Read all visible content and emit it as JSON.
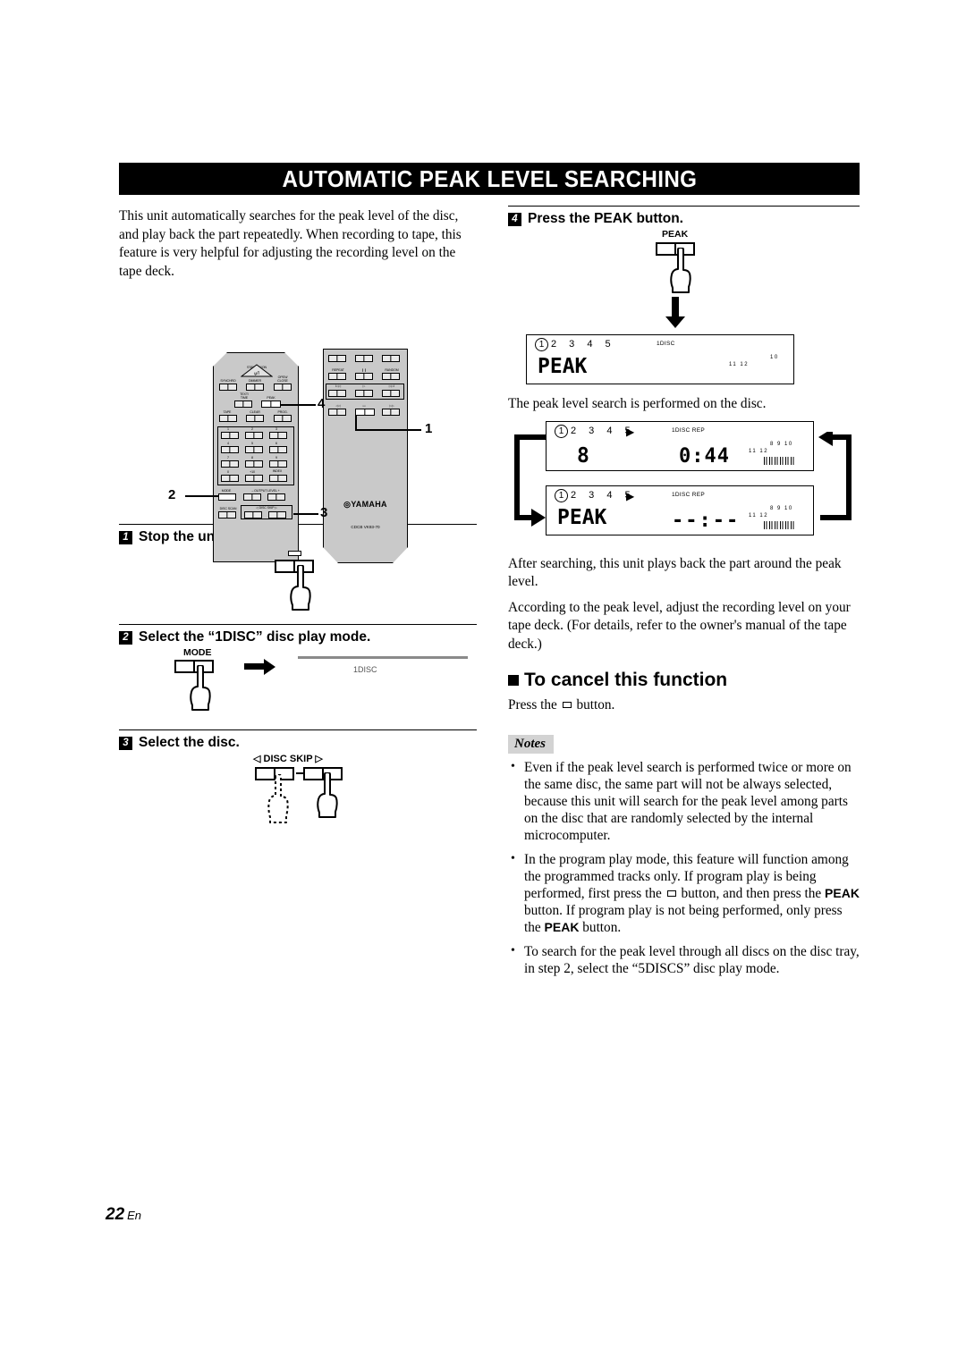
{
  "page": {
    "title": "AUTOMATIC PEAK LEVEL SEARCHING",
    "footer_number": "22",
    "footer_lang": "En"
  },
  "intro": {
    "paragraph": "This unit automatically searches for the peak level of the disc, and play back the part repeatedly. When recording to tape, this feature is very helpful for adjusting the recording level on the tape deck."
  },
  "remote": {
    "brand": "YAMAHA",
    "model": "CDCB VK93-70",
    "left_unit_labels": {
      "standby": "STANDBY/ON",
      "synchro": "SYNCHRO",
      "dimmer": "DIMMER",
      "open_close": "OPEN/\nCLOSE",
      "text_time": "TEXT/\nTIME",
      "peak": "PEAK",
      "tape": "TAPE",
      "clear": "CLEAR",
      "prog": "PROG.",
      "num1": "1",
      "num2": "2",
      "num3": "3",
      "num4": "4",
      "num5": "5",
      "num6": "6",
      "num7": "7",
      "num8": "8",
      "num9": "9",
      "num0": "0",
      "plus10": "+10",
      "index": "INDEX",
      "mode": "MODE",
      "output_level": "–  OUTPUT LEVEL  +",
      "disc_scan": "DISC SCAN",
      "disc_skip": "◁  DISC SKIP  ▷"
    },
    "right_unit_labels": {
      "repeat": "REPEAT",
      "pause": "❙❙",
      "random": "RANDOM",
      "prev": "I◁◁",
      "play": "▷",
      "next": "▷▷I",
      "search_back": "◁◁",
      "stop": "▭",
      "search_fwd": "▷▷"
    },
    "callouts": [
      "1",
      "2",
      "3",
      "4"
    ]
  },
  "steps": [
    {
      "number": "1",
      "title": "Stop the unit.",
      "button_label": ""
    },
    {
      "number": "2",
      "title": "Select the “1DISC” disc play mode.",
      "button_label": "MODE",
      "result_indicator": "1DISC"
    },
    {
      "number": "3",
      "title": "Select the disc.",
      "button_label": "◁  DISC  SKIP  ▷"
    },
    {
      "number": "4",
      "title": "Press the PEAK button.",
      "button_label": "PEAK"
    }
  ],
  "right_column": {
    "after_peak_text": "The peak level search is performed on the disc.",
    "after_search_text": "After searching, this unit plays back the part around the peak level.",
    "adjust_text": "According to the peak level, adjust the recording level on your tape deck. (For details, refer to the owner's manual of the tape deck.)",
    "cancel_heading": "To cancel this function",
    "cancel_text_before": "Press the",
    "cancel_text_after": "button."
  },
  "displays": {
    "peak_only": {
      "disc_numbers": [
        "1",
        "2",
        "3",
        "4",
        "5"
      ],
      "selected_disc": "1",
      "mode_indicator": "1DISC",
      "main_text": "PEAK",
      "tiny_labels_11_12": "11 12",
      "tiny_labels_10": "10"
    },
    "track_time": {
      "disc_numbers": [
        "1",
        "2",
        "3",
        "4",
        "5"
      ],
      "selected_disc": "1",
      "play_indicator": "▶",
      "mode_indicator": "1DISC REP",
      "track_number": "8",
      "time": "0:44",
      "tiny_labels_11_12": "11 12",
      "tiny_labels_8_9_10": "8  9 10",
      "bar_segments": 6
    },
    "peak_search": {
      "disc_numbers": [
        "1",
        "2",
        "3",
        "4",
        "5"
      ],
      "selected_disc": "1",
      "play_indicator": "▶",
      "mode_indicator": "1DISC REP",
      "main_text": "PEAK",
      "time": "--:--",
      "tiny_labels_11_12": "11 12",
      "tiny_labels_8_9_10": "8  9 10",
      "bar_segments": 6
    }
  },
  "notes": {
    "label": "Notes",
    "items": [
      "Even if the peak level search is performed twice or more on the same disc, the same part will not be always selected, because this unit will search for the peak level among parts on the disc that are randomly selected by the internal microcomputer.",
      "To search for the peak level through all discs on the disc tray, in step 2, select the “5DISCS” disc play mode."
    ],
    "program_note": {
      "part1": "In the program play mode, this feature will function among the programmed tracks only. If program play is being performed, first press the",
      "part2": "button, and then press the",
      "bold1": "PEAK",
      "part3": "button. If program play is not being performed, only press the",
      "bold2": "PEAK",
      "part4": "button."
    }
  }
}
